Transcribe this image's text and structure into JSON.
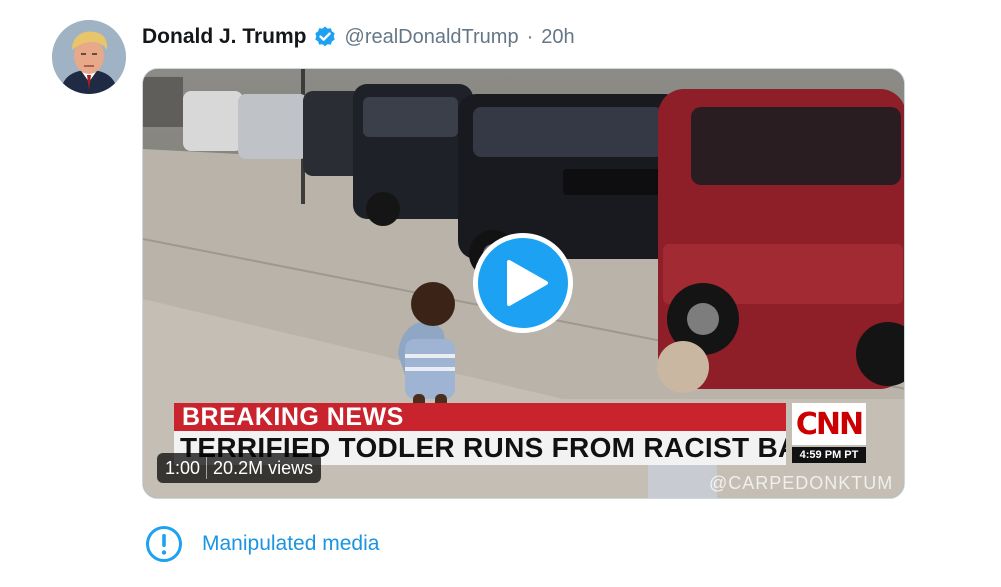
{
  "tweet": {
    "author_name": "Donald J. Trump",
    "handle": "@realDonaldTrump",
    "separator": "·",
    "time": "20h",
    "verified": true,
    "avatar_icon": "profile-photo",
    "verified_icon": "verified-badge-icon"
  },
  "video": {
    "play_icon": "play-icon",
    "duration": "1:00",
    "views": "20.2M views",
    "overlay": {
      "breaking": "BREAKING NEWS",
      "headline": "TERRIFIED TODLER RUNS FROM RACIST BABY",
      "network_logo": "CNN",
      "clock": "4:59 PM PT",
      "watermark": "@CARPEDONKTUM"
    }
  },
  "notice": {
    "icon": "exclamation-circle-icon",
    "label": "Manipulated media"
  },
  "colors": {
    "accent": "#1da1f2",
    "link": "#1b95e0",
    "muted": "#657786",
    "breaking_red": "#c9242d"
  }
}
